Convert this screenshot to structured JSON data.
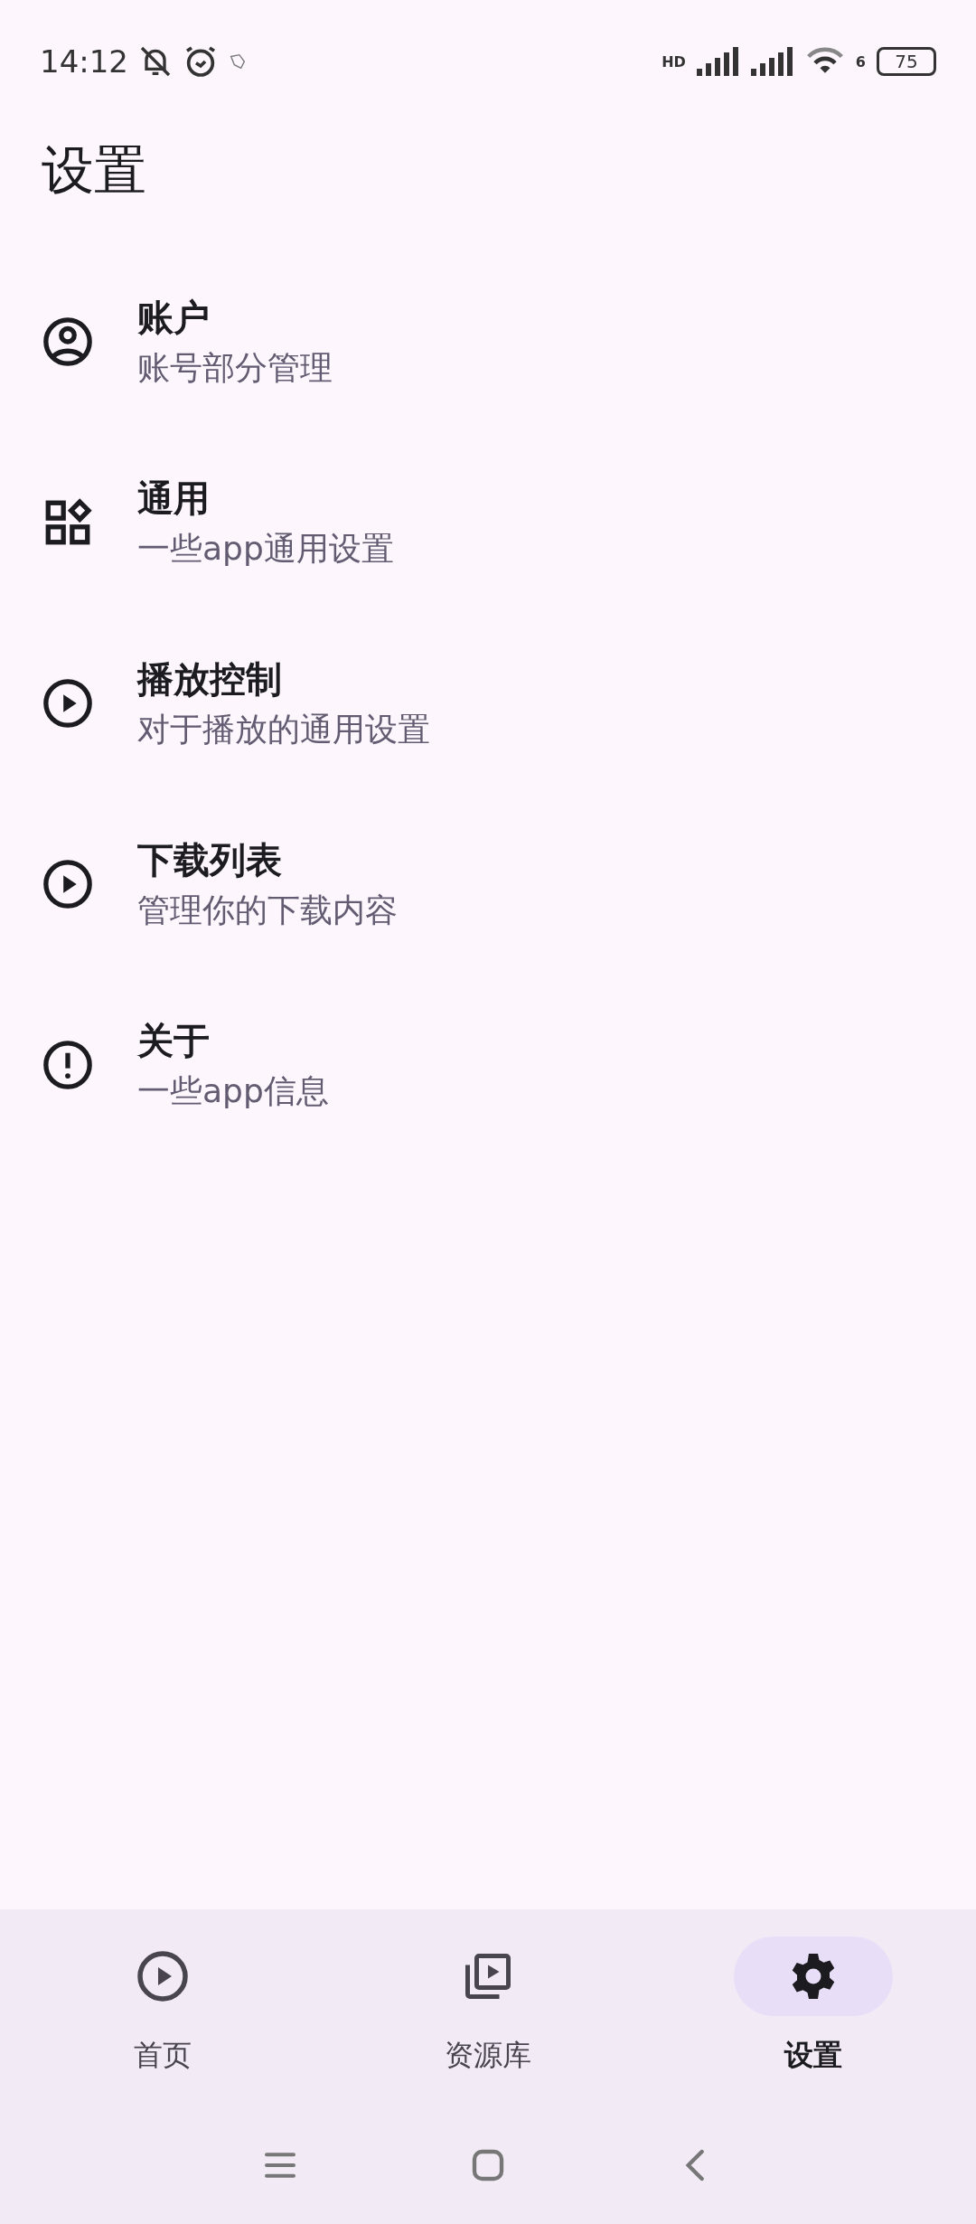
{
  "status_bar": {
    "time": "14:12",
    "network_label": "HD",
    "wifi_label": "6",
    "battery": "75"
  },
  "title": "设置",
  "items": [
    {
      "title": "账户",
      "subtitle": "账号部分管理"
    },
    {
      "title": "通用",
      "subtitle": "一些app通用设置"
    },
    {
      "title": "播放控制",
      "subtitle": "对于播放的通用设置"
    },
    {
      "title": "下载列表",
      "subtitle": "管理你的下载内容"
    },
    {
      "title": "关于",
      "subtitle": "一些app信息"
    }
  ],
  "bottom_nav": [
    {
      "label": "首页",
      "selected": false
    },
    {
      "label": "资源库",
      "selected": false
    },
    {
      "label": "设置",
      "selected": true
    }
  ]
}
